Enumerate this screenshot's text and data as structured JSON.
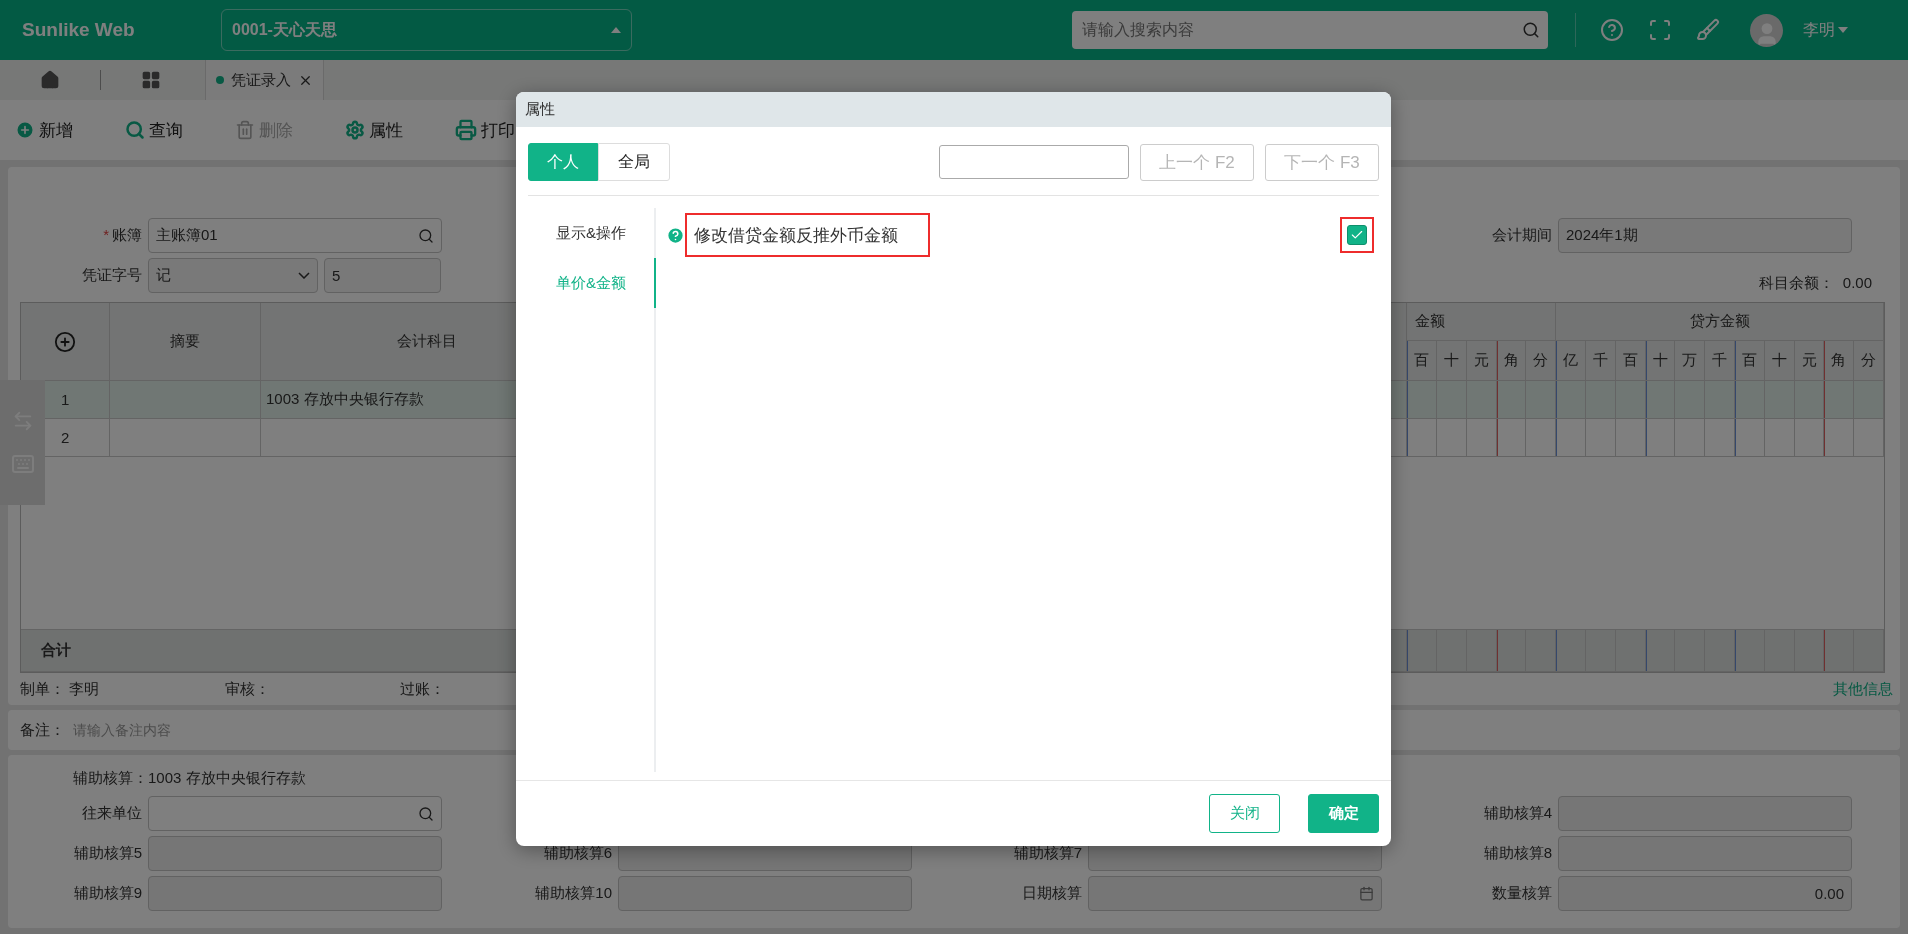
{
  "header": {
    "logo": "Sunlike Web",
    "company": "0001-天心天思",
    "search_placeholder": "请输入搜索内容",
    "user": "李明"
  },
  "tabs": [
    {
      "kind": "home"
    },
    {
      "kind": "apps"
    },
    {
      "kind": "page",
      "label": "凭证录入",
      "selected": true
    }
  ],
  "toolbar": [
    {
      "kind": "add",
      "label": "新增",
      "disabled": false
    },
    {
      "kind": "search",
      "label": "查询",
      "disabled": false
    },
    {
      "kind": "delete",
      "label": "删除",
      "disabled": true
    },
    {
      "kind": "settings",
      "label": "属性",
      "disabled": false
    },
    {
      "kind": "print",
      "label": "打印",
      "disabled": false
    }
  ],
  "form": {
    "ledger": {
      "label": "账簿",
      "required": true,
      "required_mark": "*",
      "value": "主账簿01"
    },
    "voucher": {
      "label": "凭证字号",
      "type": "记",
      "number": "5"
    },
    "period": {
      "label": "会计期间",
      "value": "2024年1期"
    },
    "balance": {
      "label": "科目余额：",
      "value": "0.00"
    }
  },
  "table": {
    "columns": {
      "summary": "摘要",
      "account": "会计科目",
      "debit": {
        "label": "金额",
        "digits": [
          "百",
          "十",
          "元",
          "角",
          "分"
        ]
      },
      "credit": {
        "label": "贷方金额",
        "digits": [
          "亿",
          "千",
          "百",
          "十",
          "万",
          "千",
          "百",
          "十",
          "元",
          "角",
          "分"
        ]
      }
    },
    "rows": [
      {
        "index": "1",
        "account": "1003 存放中央银行存款",
        "selected": true
      },
      {
        "index": "2",
        "selected": false
      }
    ],
    "total_label": "合计"
  },
  "signatures": [
    {
      "label": "制单：",
      "value": "李明"
    },
    {
      "label": "审核："
    },
    {
      "label": "过账："
    }
  ],
  "other_info_link": "其他信息",
  "remark": {
    "label": "备注：",
    "placeholder": "请输入备注内容"
  },
  "aux": {
    "label": "辅助核算：",
    "value": "1003 存放中央银行存款",
    "rows": [
      [
        {
          "label": "往来单位",
          "kind": "search"
        },
        null,
        null,
        {
          "label": "辅助核算4",
          "kind": "text"
        }
      ],
      [
        {
          "label": "辅助核算5",
          "kind": "text"
        },
        {
          "label": "辅助核算6",
          "kind": "text"
        },
        {
          "label": "辅助核算7",
          "kind": "text"
        },
        {
          "label": "辅助核算8",
          "kind": "text"
        }
      ],
      [
        {
          "label": "辅助核算9",
          "kind": "text"
        },
        {
          "label": "辅助核算10",
          "kind": "text"
        },
        {
          "label": "日期核算",
          "kind": "date"
        },
        {
          "label": "数量核算",
          "kind": "text",
          "value": "0.00"
        }
      ]
    ]
  },
  "dialog": {
    "title": "属性",
    "scopes": [
      {
        "label": "个人",
        "selected": true
      },
      {
        "label": "全局",
        "selected": false
      }
    ],
    "nav_buttons": [
      {
        "label": "上一个 F2",
        "disabled": true
      },
      {
        "label": "下一个 F3",
        "disabled": true
      }
    ],
    "categories": [
      {
        "label": "显示&操作",
        "selected": false
      },
      {
        "label": "单价&金额",
        "selected": true
      }
    ],
    "options": [
      {
        "label": "修改借贷金额反推外币金额",
        "checked": true,
        "highlighted": true
      }
    ],
    "buttons": [
      {
        "label": "关闭",
        "kind": "secondary"
      },
      {
        "label": "确定",
        "kind": "primary"
      }
    ]
  }
}
